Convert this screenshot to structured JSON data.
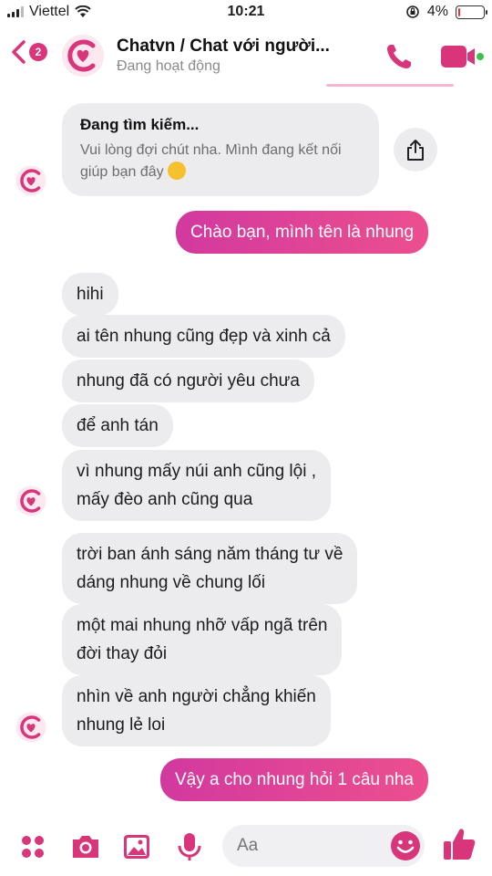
{
  "status_bar": {
    "carrier": "Viettel",
    "time": "10:21",
    "battery": "4%",
    "battery_level": 0.04
  },
  "header": {
    "back_count": "2",
    "title": "Chatvn / Chat với người...",
    "subtitle": "Đang hoạt động"
  },
  "search_card": {
    "title": "Đang tìm kiếm...",
    "text": "Vui lòng đợi chút nha. Mình đang kết nối giúp bạn đây"
  },
  "messages": [
    {
      "side": "out",
      "text": "Chào bạn, mình tên là nhung"
    },
    {
      "side": "in",
      "text": "hihi"
    },
    {
      "side": "in",
      "text": "ai tên nhung cũng đẹp và xinh cả"
    },
    {
      "side": "in",
      "text": "nhung đã có người yêu chưa"
    },
    {
      "side": "in",
      "text": "để anh tán"
    },
    {
      "side": "in",
      "text": "vì nhung mấy  núi anh cũng lội ,\nmấy đèo anh cũng qua"
    },
    {
      "side": "in",
      "text": "trời ban ánh sáng năm tháng tư về\ndáng nhung về chung lối"
    },
    {
      "side": "in",
      "text": "một mai nhung nhỡ vấp ngã trên\nđời thay đỏi"
    },
    {
      "side": "in",
      "text": "nhìn về anh người chẳng khiến\nnhung lẻ loi"
    },
    {
      "side": "out",
      "text": "Vậy a cho nhung hỏi 1 câu nha"
    }
  ],
  "composer": {
    "placeholder": "Aa"
  },
  "colors": {
    "accent": "#d8357a",
    "bubble_in": "#ececef",
    "bubble_out_start": "#d2399f",
    "bubble_out_end": "#ec4f8e"
  },
  "icons": [
    "chevron-left-icon",
    "phone-icon",
    "video-camera-icon",
    "share-icon",
    "apps-icon",
    "camera-icon",
    "image-icon",
    "microphone-icon",
    "emoji-icon",
    "thumbs-up-icon"
  ]
}
